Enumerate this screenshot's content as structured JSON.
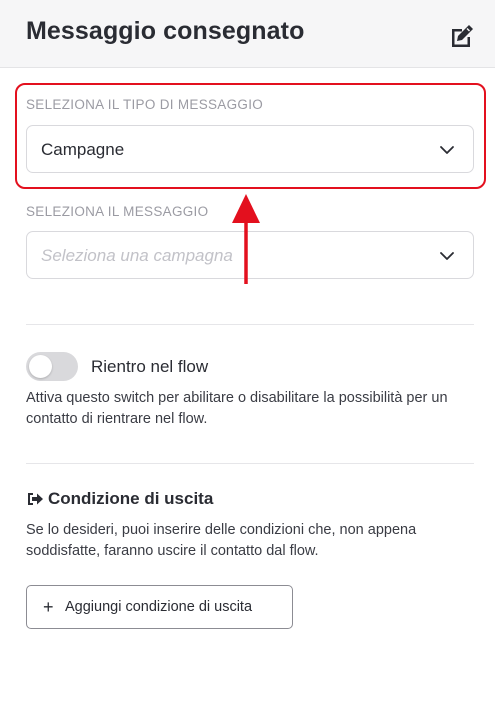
{
  "header": {
    "title": "Messaggio consegnato",
    "edit_icon": "edit-icon"
  },
  "message_type": {
    "label": "SELEZIONA IL TIPO DI MESSAGGIO",
    "selected": "Campagne",
    "chevron_icon": "chevron-down-icon"
  },
  "message": {
    "label": "SELEZIONA IL MESSAGGIO",
    "placeholder": "Seleziona una campagna",
    "chevron_icon": "chevron-down-icon"
  },
  "reentry": {
    "label": "Rientro nel flow",
    "enabled": false,
    "help": "Attiva questo switch per abilitare o disabilitare la possibilità per un contatto di rientrare nel flow."
  },
  "exit_condition": {
    "title": "Condizione di uscita",
    "icon": "sign-out-icon",
    "help": "Se lo desideri, puoi inserire delle condizioni che, non appena soddisfatte, faranno uscire il contatto dal flow.",
    "add_button_plus": "+",
    "add_button_label": "Aggiungi condizione di uscita"
  },
  "colors": {
    "highlight": "#e3101e",
    "arrow": "#e3101e"
  }
}
